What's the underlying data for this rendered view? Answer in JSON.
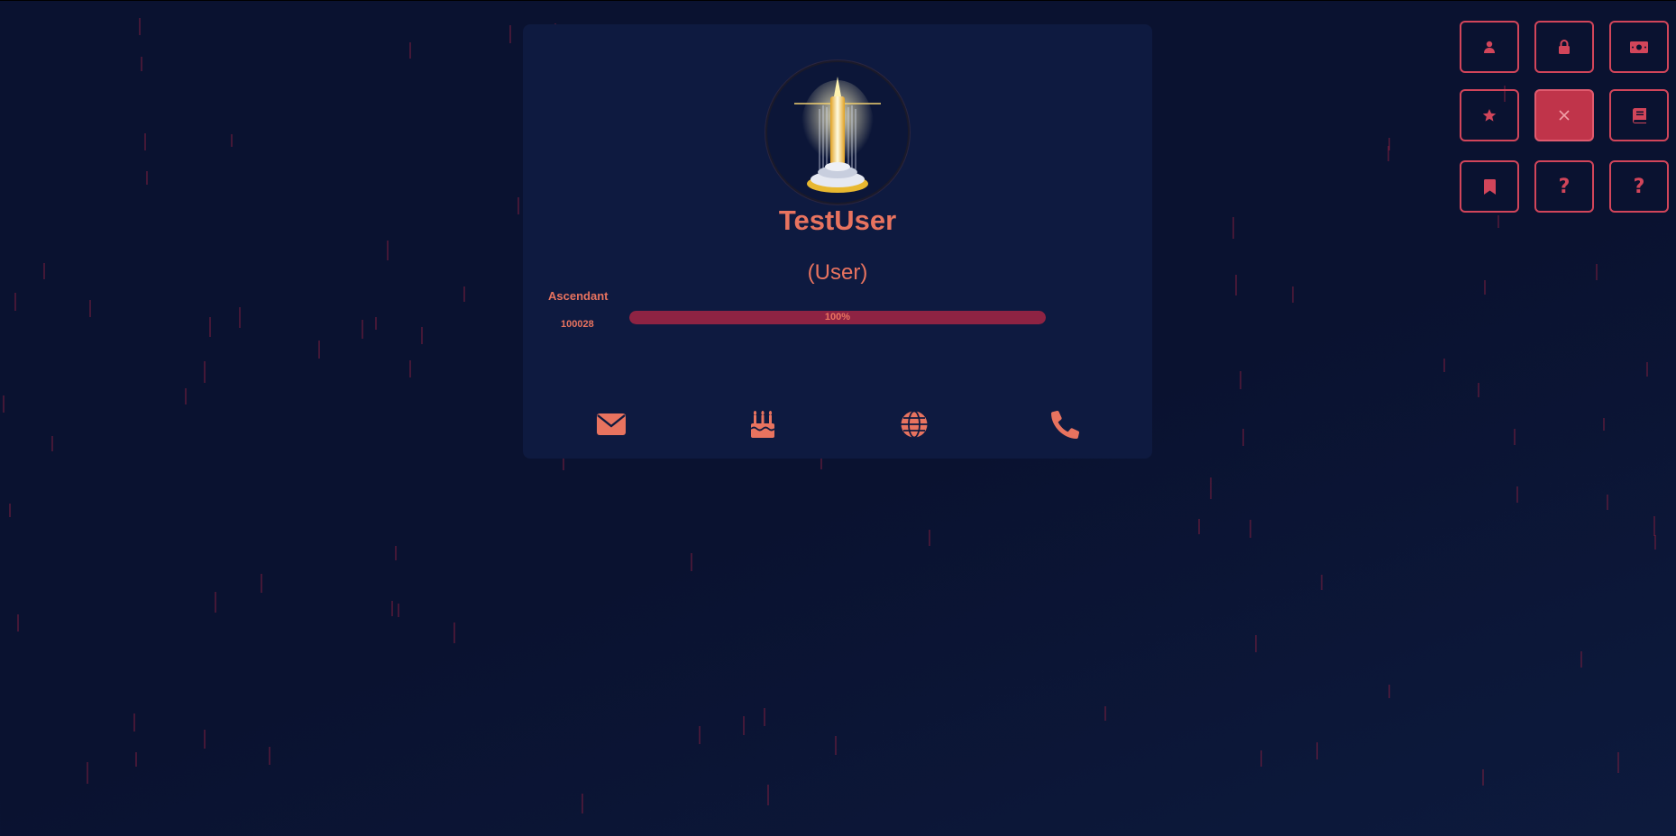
{
  "profile": {
    "username": "TestUser",
    "role": "(User)",
    "rank": {
      "name": "Ascendant",
      "points": "100028",
      "progress_label": "100%",
      "progress_value": 1.0
    }
  },
  "contacts": [
    {
      "icon": "envelope-icon"
    },
    {
      "icon": "birthday-cake-icon"
    },
    {
      "icon": "globe-icon"
    },
    {
      "icon": "phone-icon"
    }
  ],
  "side_menu": {
    "buttons": [
      {
        "icon": "user-icon"
      },
      {
        "icon": "lock-icon"
      },
      {
        "icon": "money-bill-icon"
      },
      {
        "icon": "star-icon"
      },
      {
        "icon": "close-icon",
        "active": true
      },
      {
        "icon": "book-icon"
      },
      {
        "icon": "bookmark-icon"
      },
      {
        "icon": "question-icon",
        "label": "?"
      },
      {
        "icon": "question-icon",
        "label": "?"
      }
    ]
  },
  "colors": {
    "background": "#0a1230",
    "card": "#0e1a40",
    "accent": "#e8735f",
    "button_border": "#d2455a",
    "button_active": "#c0344a",
    "progress_fill": "#8e2343"
  }
}
